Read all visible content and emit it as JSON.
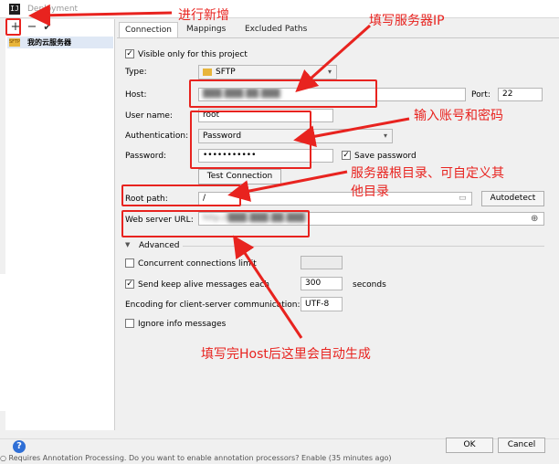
{
  "window": {
    "title": "Deployment"
  },
  "toolbar": {
    "add": "+",
    "remove": "−",
    "apply": "✔"
  },
  "servers": [
    {
      "badge": "SFTP",
      "name": "我的云服务器"
    }
  ],
  "tabs": [
    {
      "label": "Connection"
    },
    {
      "label": "Mappings"
    },
    {
      "label": "Excluded Paths"
    }
  ],
  "connection": {
    "visible_only_label": "Visible only for this project",
    "visible_only_checked": true,
    "type_label": "Type:",
    "type_value": "SFTP",
    "host_label": "Host:",
    "host_value": "███.███.██.███",
    "port_label": "Port:",
    "port_value": "22",
    "user_label": "User name:",
    "user_value": "root",
    "auth_label": "Authentication:",
    "auth_value": "Password",
    "password_label": "Password:",
    "password_value": "•••••••••••",
    "save_password_label": "Save password",
    "save_password_checked": true,
    "test_button": "Test Connection",
    "root_label": "Root path:",
    "root_value": "/",
    "autodetect_button": "Autodetect",
    "web_label": "Web server URL:",
    "web_value": "http://███.███.██.███"
  },
  "advanced": {
    "header": "Advanced",
    "concurrent_label": "Concurrent connections limit",
    "keepalive_label": "Send keep alive messages each",
    "keepalive_value": "300",
    "keepalive_unit": "seconds",
    "encoding_label": "Encoding for client-server communication:",
    "encoding_value": "UTF-8",
    "ignore_label": "Ignore info messages"
  },
  "annotations": {
    "add_new": "进行新增",
    "fill_ip": "填写服务器IP",
    "account_pwd": "输入账号和密码",
    "root_dir_line1": "服务器根目录、可自定义其",
    "root_dir_line2": "他目录",
    "auto_gen": "填写完Host后这里会自动生成",
    "accent_color": "#e8231f"
  },
  "footer": {
    "help": "?",
    "ok_button": "OK",
    "cancel_button": "Cancel",
    "note": "○ Requires Annotation Processing. Do you want to enable annotation processors? Enable (35 minutes ago)"
  }
}
